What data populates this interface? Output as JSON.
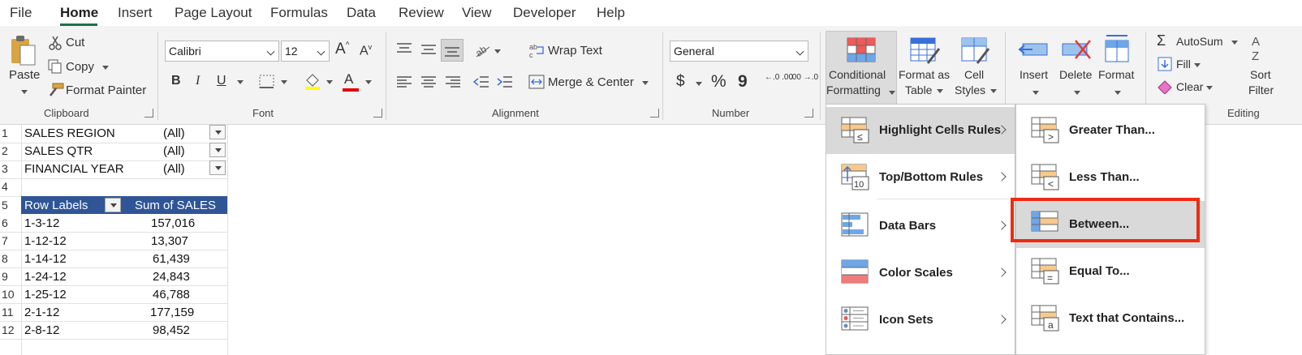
{
  "menubar": {
    "tabs": [
      "File",
      "Home",
      "Insert",
      "Page Layout",
      "Formulas",
      "Data",
      "Review",
      "View",
      "Developer",
      "Help"
    ],
    "active": "Home"
  },
  "ribbon": {
    "clipboard": {
      "paste": "Paste",
      "cut": "Cut",
      "copy": "Copy",
      "format_painter": "Format Painter",
      "label": "Clipboard"
    },
    "font": {
      "name": "Calibri",
      "size": "12",
      "grow": "A",
      "shrink": "A",
      "bold": "B",
      "italic": "I",
      "underline": "U",
      "font_color_letter": "A",
      "label": "Font"
    },
    "alignment": {
      "wrap_text": "Wrap Text",
      "merge_center": "Merge & Center",
      "label": "Alignment"
    },
    "number": {
      "format": "General",
      "currency": "$",
      "percent": "%",
      "comma": "9",
      "inc_dec": "←.0 .00",
      "dec_dec": ".00 →.0",
      "label": "Number"
    },
    "styles": {
      "cf_line1": "Conditional",
      "cf_line2": "Formatting",
      "fat_line1": "Format as",
      "fat_line2": "Table",
      "cs_line1": "Cell",
      "cs_line2": "Styles"
    },
    "cells": {
      "insert": "Insert",
      "delete": "Delete",
      "format": "Format"
    },
    "editing": {
      "autosum": "AutoSum",
      "fill": "Fill",
      "clear": "Clear",
      "sort_line1": "Sort",
      "sort_line2": "Filter",
      "label": "Editing"
    }
  },
  "sheet": {
    "row_numbers": [
      "1",
      "2",
      "3",
      "4",
      "5",
      "6",
      "7",
      "8",
      "9",
      "10",
      "11",
      "12"
    ],
    "filters": [
      {
        "label": "SALES REGION",
        "value": "(All)"
      },
      {
        "label": "SALES QTR",
        "value": "(All)"
      },
      {
        "label": "FINANCIAL YEAR",
        "value": "(All)"
      }
    ],
    "pivot_headers": [
      "Row Labels",
      "Sum of SALES"
    ],
    "pivot_rows": [
      {
        "label": "1-3-12",
        "value": "157,016"
      },
      {
        "label": "1-12-12",
        "value": "13,307"
      },
      {
        "label": "1-14-12",
        "value": "61,439"
      },
      {
        "label": "1-24-12",
        "value": "24,843"
      },
      {
        "label": "1-25-12",
        "value": "46,788"
      },
      {
        "label": "2-1-12",
        "value": "177,159"
      },
      {
        "label": "2-8-12",
        "value": "98,452"
      }
    ]
  },
  "cf_menu": {
    "items": [
      "Highlight Cells Rules",
      "Top/Bottom Rules",
      "Data Bars",
      "Color Scales",
      "Icon Sets"
    ],
    "highlighted": "Highlight Cells Rules"
  },
  "hcr_submenu": {
    "items": [
      "Greater Than...",
      "Less Than...",
      "Between...",
      "Equal To...",
      "Text that Contains..."
    ],
    "highlighted": "Between..."
  },
  "colors": {
    "accent_green": "#1e7145",
    "pivot_header": "#2f5597",
    "highlight_box": "#ee2b12"
  }
}
